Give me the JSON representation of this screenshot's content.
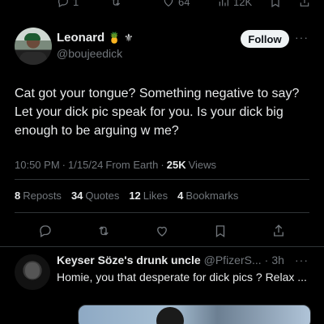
{
  "top_actions": {
    "replies": "1",
    "likes": "64",
    "views": "12K"
  },
  "tweet": {
    "display_name": "Leonard",
    "name_emojis": "🍍 ⚜",
    "handle": "@boujeedick",
    "follow_label": "Follow",
    "more": "···",
    "text": "Cat got your tongue? Something negative to say? Let your dick pic speak for you. Is your dick big enough to be arguing w me?",
    "time": "10:50 PM",
    "date": "1/15/24",
    "source": "From Earth",
    "separator": "·",
    "views_count": "25K",
    "views_label": "Views"
  },
  "stats": [
    {
      "num": "8",
      "label": "Reposts"
    },
    {
      "num": "34",
      "label": "Quotes"
    },
    {
      "num": "12",
      "label": "Likes"
    },
    {
      "num": "4",
      "label": "Bookmarks"
    }
  ],
  "reply": {
    "name": "Keyser Söze's drunk uncle",
    "handle": "@PfizerS...",
    "separator": "·",
    "time": "3h",
    "more": "···",
    "text": "Homie, you that desperate for dick pics ? Relax ..."
  },
  "icons": {
    "reply": "reply-icon",
    "repost": "repost-icon",
    "like": "heart-icon",
    "views": "views-icon",
    "bookmark": "bookmark-icon",
    "share": "share-icon"
  },
  "colors": {
    "background": "#000000",
    "text": "#e7e9ea",
    "muted": "#71767b",
    "divider": "#2f3336",
    "follow_bg": "#eff3f4"
  }
}
